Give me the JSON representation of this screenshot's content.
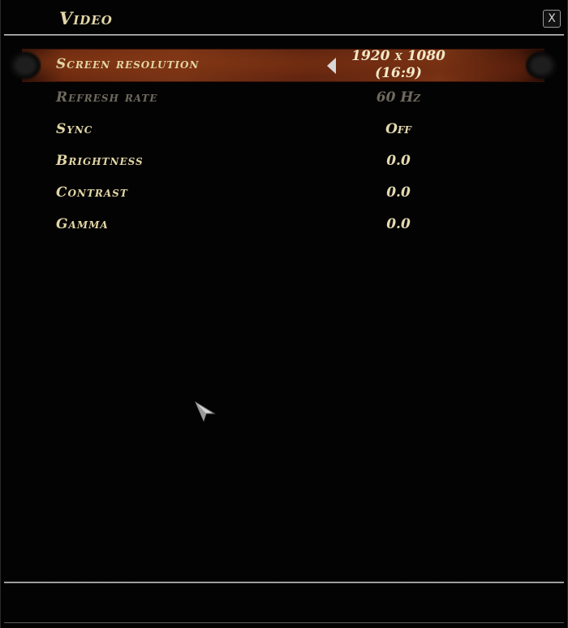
{
  "window": {
    "title": "Video",
    "close_label": "X"
  },
  "settings": [
    {
      "label": "Screen resolution",
      "value_line1": "1920 x 1080",
      "value_line2": "(16:9)",
      "selected": true,
      "enabled": true
    },
    {
      "label": "Refresh rate",
      "value": "60 Hz",
      "selected": false,
      "enabled": false
    },
    {
      "label": "Sync",
      "value": "Off",
      "selected": false,
      "enabled": true
    },
    {
      "label": "Brightness",
      "value": "0.0",
      "selected": false,
      "enabled": true
    },
    {
      "label": "Contrast",
      "value": "0.0",
      "selected": false,
      "enabled": true
    },
    {
      "label": "Gamma",
      "value": "0.0",
      "selected": false,
      "enabled": true
    }
  ],
  "icons": {
    "close": "close-icon",
    "prev": "arrow-left-icon",
    "cursor": "mouse-cursor-icon"
  },
  "colors": {
    "text": "#e2d5a6",
    "disabled_text": "#6f6a5e",
    "highlight": "#7a3416",
    "background": "#030303"
  }
}
